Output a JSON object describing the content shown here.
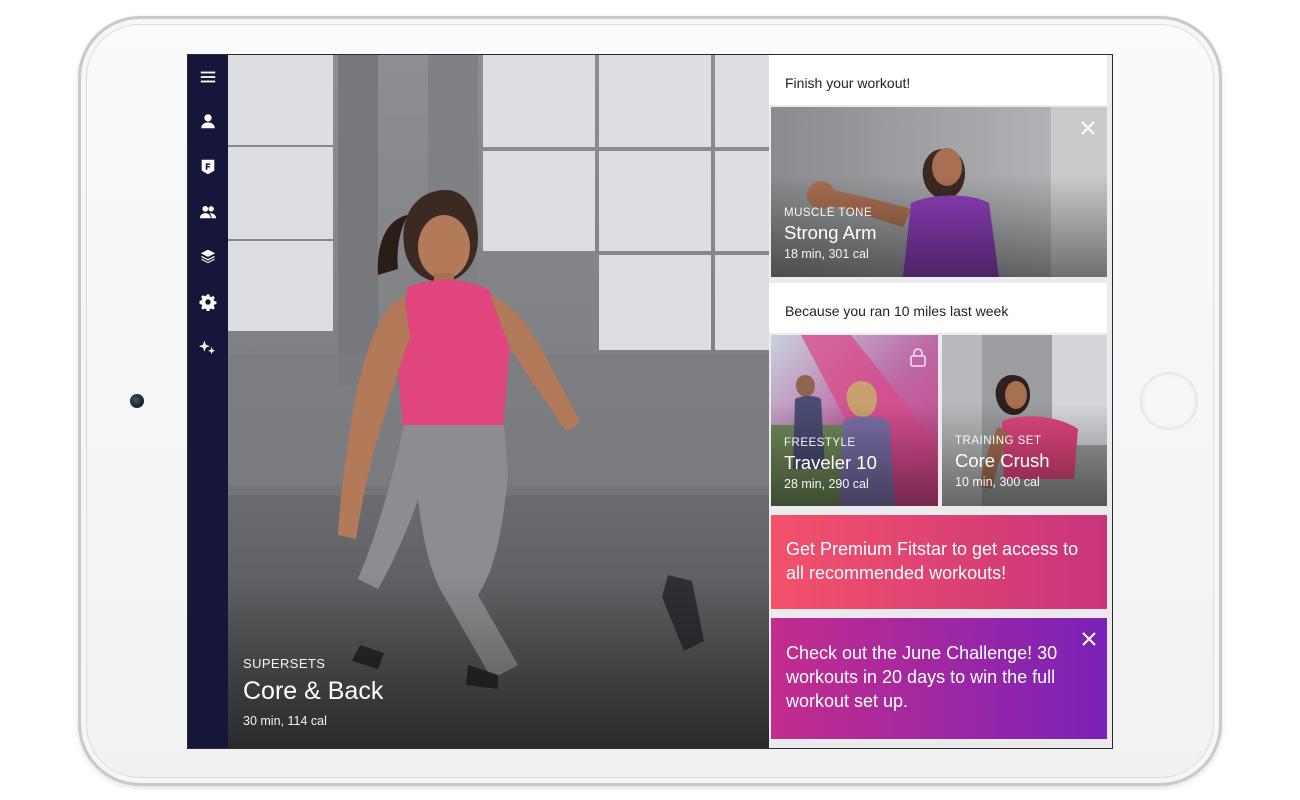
{
  "sidebar": {
    "icons": [
      "menu-icon",
      "profile-icon",
      "fitstar-badge-icon",
      "friends-icon",
      "layers-icon",
      "gear-icon",
      "sparkle-icon"
    ]
  },
  "hero": {
    "category": "SUPERSETS",
    "title": "Core & Back",
    "meta": "30 min, 114 cal"
  },
  "panel": {
    "finish_heading": "Finish your workout!",
    "finish_card": {
      "category": "MUSCLE TONE",
      "title": "Strong Arm",
      "meta": "18 min, 301 cal"
    },
    "because_heading": "Because you ran 10 miles last week",
    "recommended": [
      {
        "category": "FREESTYLE",
        "title": "Traveler 10",
        "meta": "28 min, 290 cal",
        "locked": true
      },
      {
        "category": "TRAINING SET",
        "title": "Core Crush",
        "meta": "10 min, 300 cal",
        "locked": false
      }
    ],
    "premium_promo": "Get Premium Fitstar to get access to all recommended workouts!",
    "challenge_promo": "Check out the June Challenge! 30 workouts in 20 days to win the full workout set up."
  },
  "colors": {
    "sidebar_bg": "#15163a",
    "premium_gradient_start": "#f4516a",
    "premium_gradient_end": "#c8347c",
    "challenge_gradient_start": "#c42d8c",
    "challenge_gradient_end": "#7a22b8"
  }
}
